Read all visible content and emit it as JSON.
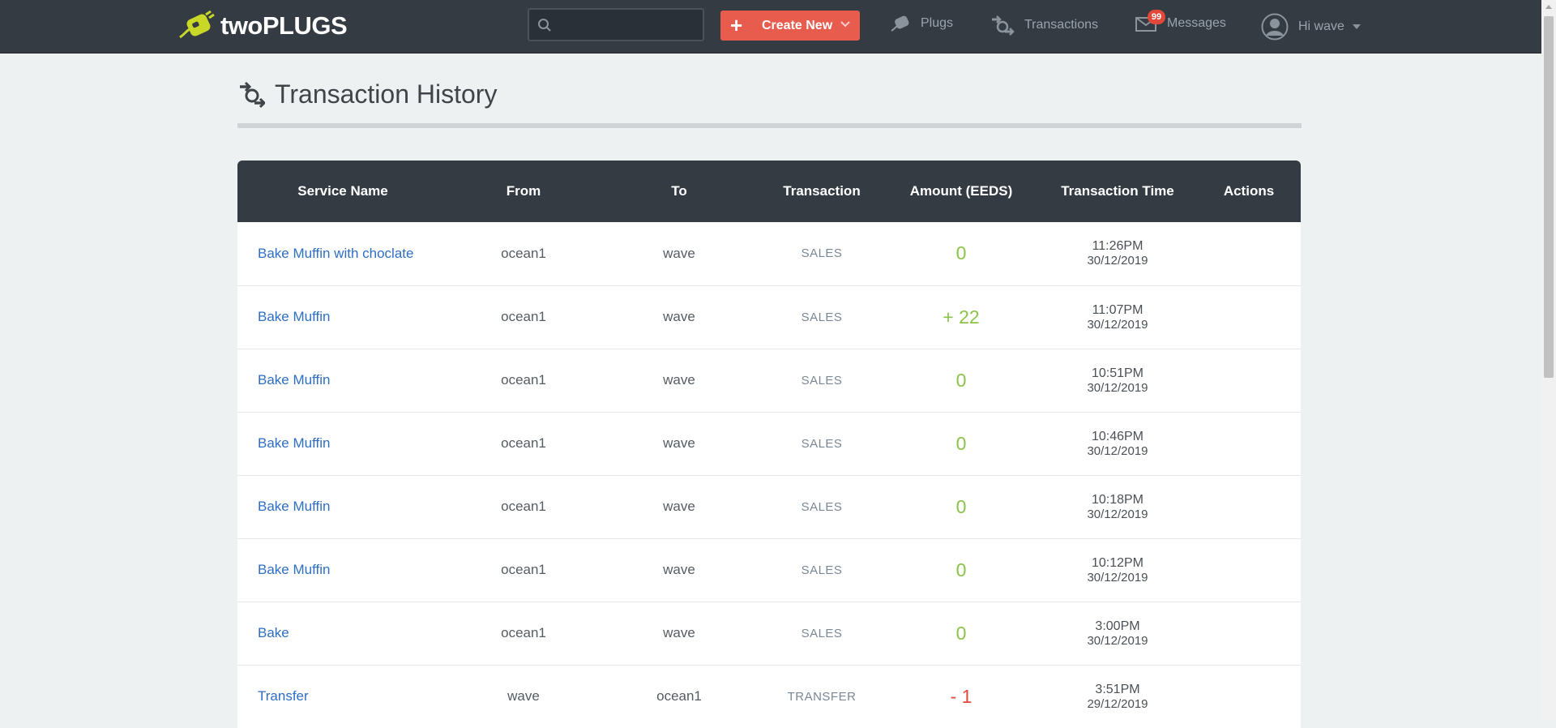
{
  "header": {
    "logo_text": "twoPLUGS",
    "search_placeholder": "",
    "create_label": "Create New",
    "nav": {
      "plugs": "Plugs",
      "transactions": "Transactions",
      "messages": "Messages",
      "messages_badge": "99",
      "user": "Hi wave"
    }
  },
  "page": {
    "title": "Transaction History"
  },
  "table": {
    "columns": [
      "Service Name",
      "From",
      "To",
      "Transaction",
      "Amount (EEDS)",
      "Transaction Time",
      "Actions"
    ],
    "rows": [
      {
        "service": "Bake Muffin with choclate",
        "from": "ocean1",
        "to": "wave",
        "type": "SALES",
        "amount": "0",
        "time": "11:26PM",
        "date": "30/12/2019",
        "negative": false
      },
      {
        "service": "Bake Muffin",
        "from": "ocean1",
        "to": "wave",
        "type": "SALES",
        "amount": "+ 22",
        "time": "11:07PM",
        "date": "30/12/2019",
        "negative": false
      },
      {
        "service": "Bake Muffin",
        "from": "ocean1",
        "to": "wave",
        "type": "SALES",
        "amount": "0",
        "time": "10:51PM",
        "date": "30/12/2019",
        "negative": false
      },
      {
        "service": "Bake Muffin",
        "from": "ocean1",
        "to": "wave",
        "type": "SALES",
        "amount": "0",
        "time": "10:46PM",
        "date": "30/12/2019",
        "negative": false
      },
      {
        "service": "Bake Muffin",
        "from": "ocean1",
        "to": "wave",
        "type": "SALES",
        "amount": "0",
        "time": "10:18PM",
        "date": "30/12/2019",
        "negative": false
      },
      {
        "service": "Bake Muffin",
        "from": "ocean1",
        "to": "wave",
        "type": "SALES",
        "amount": "0",
        "time": "10:12PM",
        "date": "30/12/2019",
        "negative": false
      },
      {
        "service": "Bake",
        "from": "ocean1",
        "to": "wave",
        "type": "SALES",
        "amount": "0",
        "time": "3:00PM",
        "date": "30/12/2019",
        "negative": false
      },
      {
        "service": "Transfer",
        "from": "wave",
        "to": "ocean1",
        "type": "TRANSFER",
        "amount": "- 1",
        "time": "3:51PM",
        "date": "29/12/2019",
        "negative": true
      }
    ]
  },
  "colors": {
    "topbar": "#343b43",
    "accent_red": "#e85c4d",
    "positive_amount": "#8bc34a",
    "negative_amount": "#e2493b",
    "link": "#2e6ec4"
  }
}
